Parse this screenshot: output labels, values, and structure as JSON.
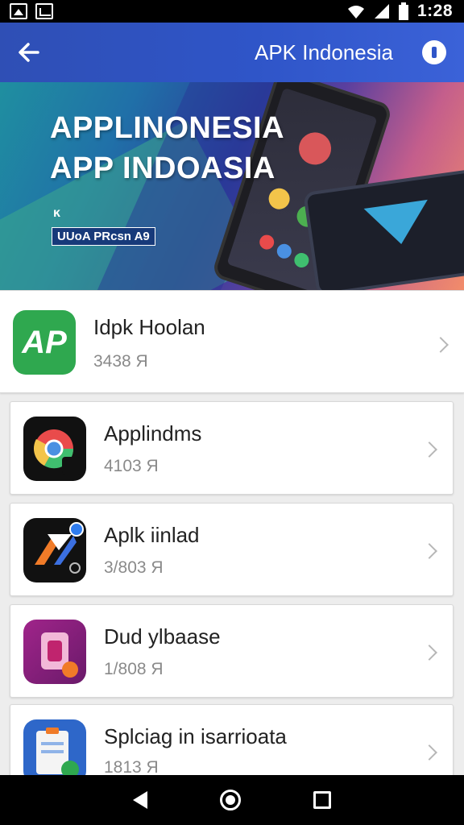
{
  "status_bar": {
    "time": "1:28"
  },
  "header": {
    "title": "APK Indonesia"
  },
  "banner": {
    "title_line1": "APPLINONESIA",
    "title_line2": "APP INDOASIA",
    "small_label": "ĸ",
    "tag": "UUoA PRcsn A9"
  },
  "apps": [
    {
      "name": "Idpk Hoolan",
      "subtitle": "3438 Я",
      "icon_text": "AP",
      "icon_color": "#2fa84f"
    },
    {
      "name": "Applindms",
      "subtitle": "4103 Я",
      "icon_text": "",
      "icon_color": "#111111"
    },
    {
      "name": "Aplk iinlad",
      "subtitle": "3/803 Я",
      "icon_text": "",
      "icon_color": "#1a1a2e"
    },
    {
      "name": "Dud ylbaase",
      "subtitle": "1/808 Я",
      "icon_text": "",
      "icon_color": "#8a1a7a"
    },
    {
      "name": "Splciag in isarrioata",
      "subtitle": "1813 Я",
      "icon_text": "",
      "icon_color": "#2e67c9"
    }
  ],
  "colors": {
    "header": "#2f55c8",
    "accent_green": "#2fa84f"
  }
}
